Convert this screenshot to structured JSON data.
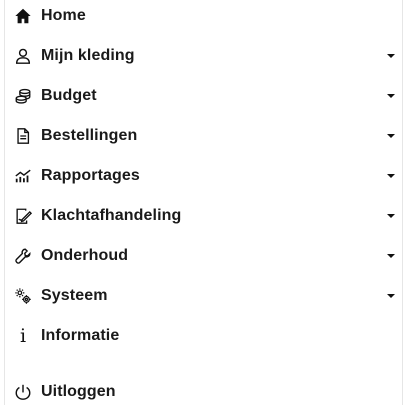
{
  "menu": {
    "items": [
      {
        "label": "Home",
        "icon": "home-icon",
        "has_submenu": false
      },
      {
        "label": "Mijn kleding",
        "icon": "user-icon",
        "has_submenu": true
      },
      {
        "label": "Budget",
        "icon": "coins-icon",
        "has_submenu": true
      },
      {
        "label": "Bestellingen",
        "icon": "document-icon",
        "has_submenu": true
      },
      {
        "label": "Rapportages",
        "icon": "chart-icon",
        "has_submenu": true
      },
      {
        "label": "Klachtafhandeling",
        "icon": "signature-icon",
        "has_submenu": true
      },
      {
        "label": "Onderhoud",
        "icon": "wrench-icon",
        "has_submenu": true
      },
      {
        "label": "Systeem",
        "icon": "gears-icon",
        "has_submenu": true
      },
      {
        "label": "Informatie",
        "icon": "info-icon",
        "has_submenu": false
      },
      {
        "label": "Uitloggen",
        "icon": "power-icon",
        "has_submenu": false
      }
    ]
  }
}
